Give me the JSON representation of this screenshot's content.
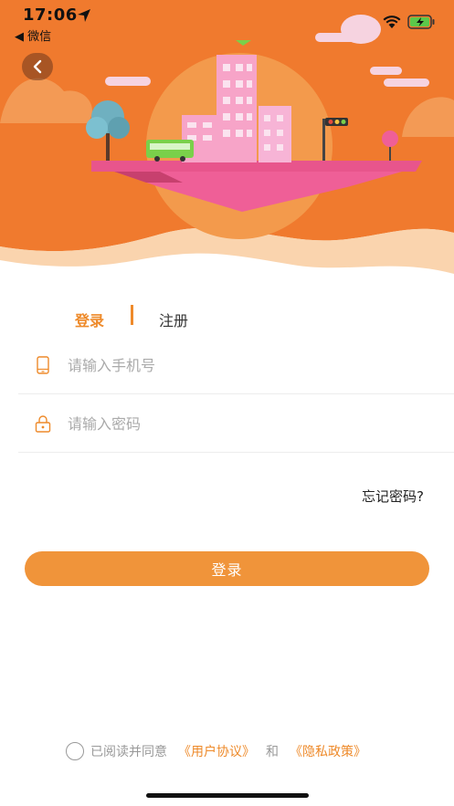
{
  "status_bar": {
    "time": "17:06",
    "back_app_label": "◀ 微信"
  },
  "hero": {
    "background_color": "#f07a2e",
    "accent_color": "#e8558c"
  },
  "tabs": {
    "login_label": "登录",
    "register_label": "注册"
  },
  "form": {
    "phone_placeholder": "请输入手机号",
    "password_placeholder": "请输入密码",
    "forgot_label": "忘记密码?",
    "submit_label": "登录"
  },
  "agreement": {
    "prefix": "已阅读并同意",
    "user_agreement": "《用户协议》",
    "and": "和",
    "privacy_policy": "《隐私政策》"
  },
  "colors": {
    "accent": "#ee8a2a",
    "button": "#f0943a"
  }
}
